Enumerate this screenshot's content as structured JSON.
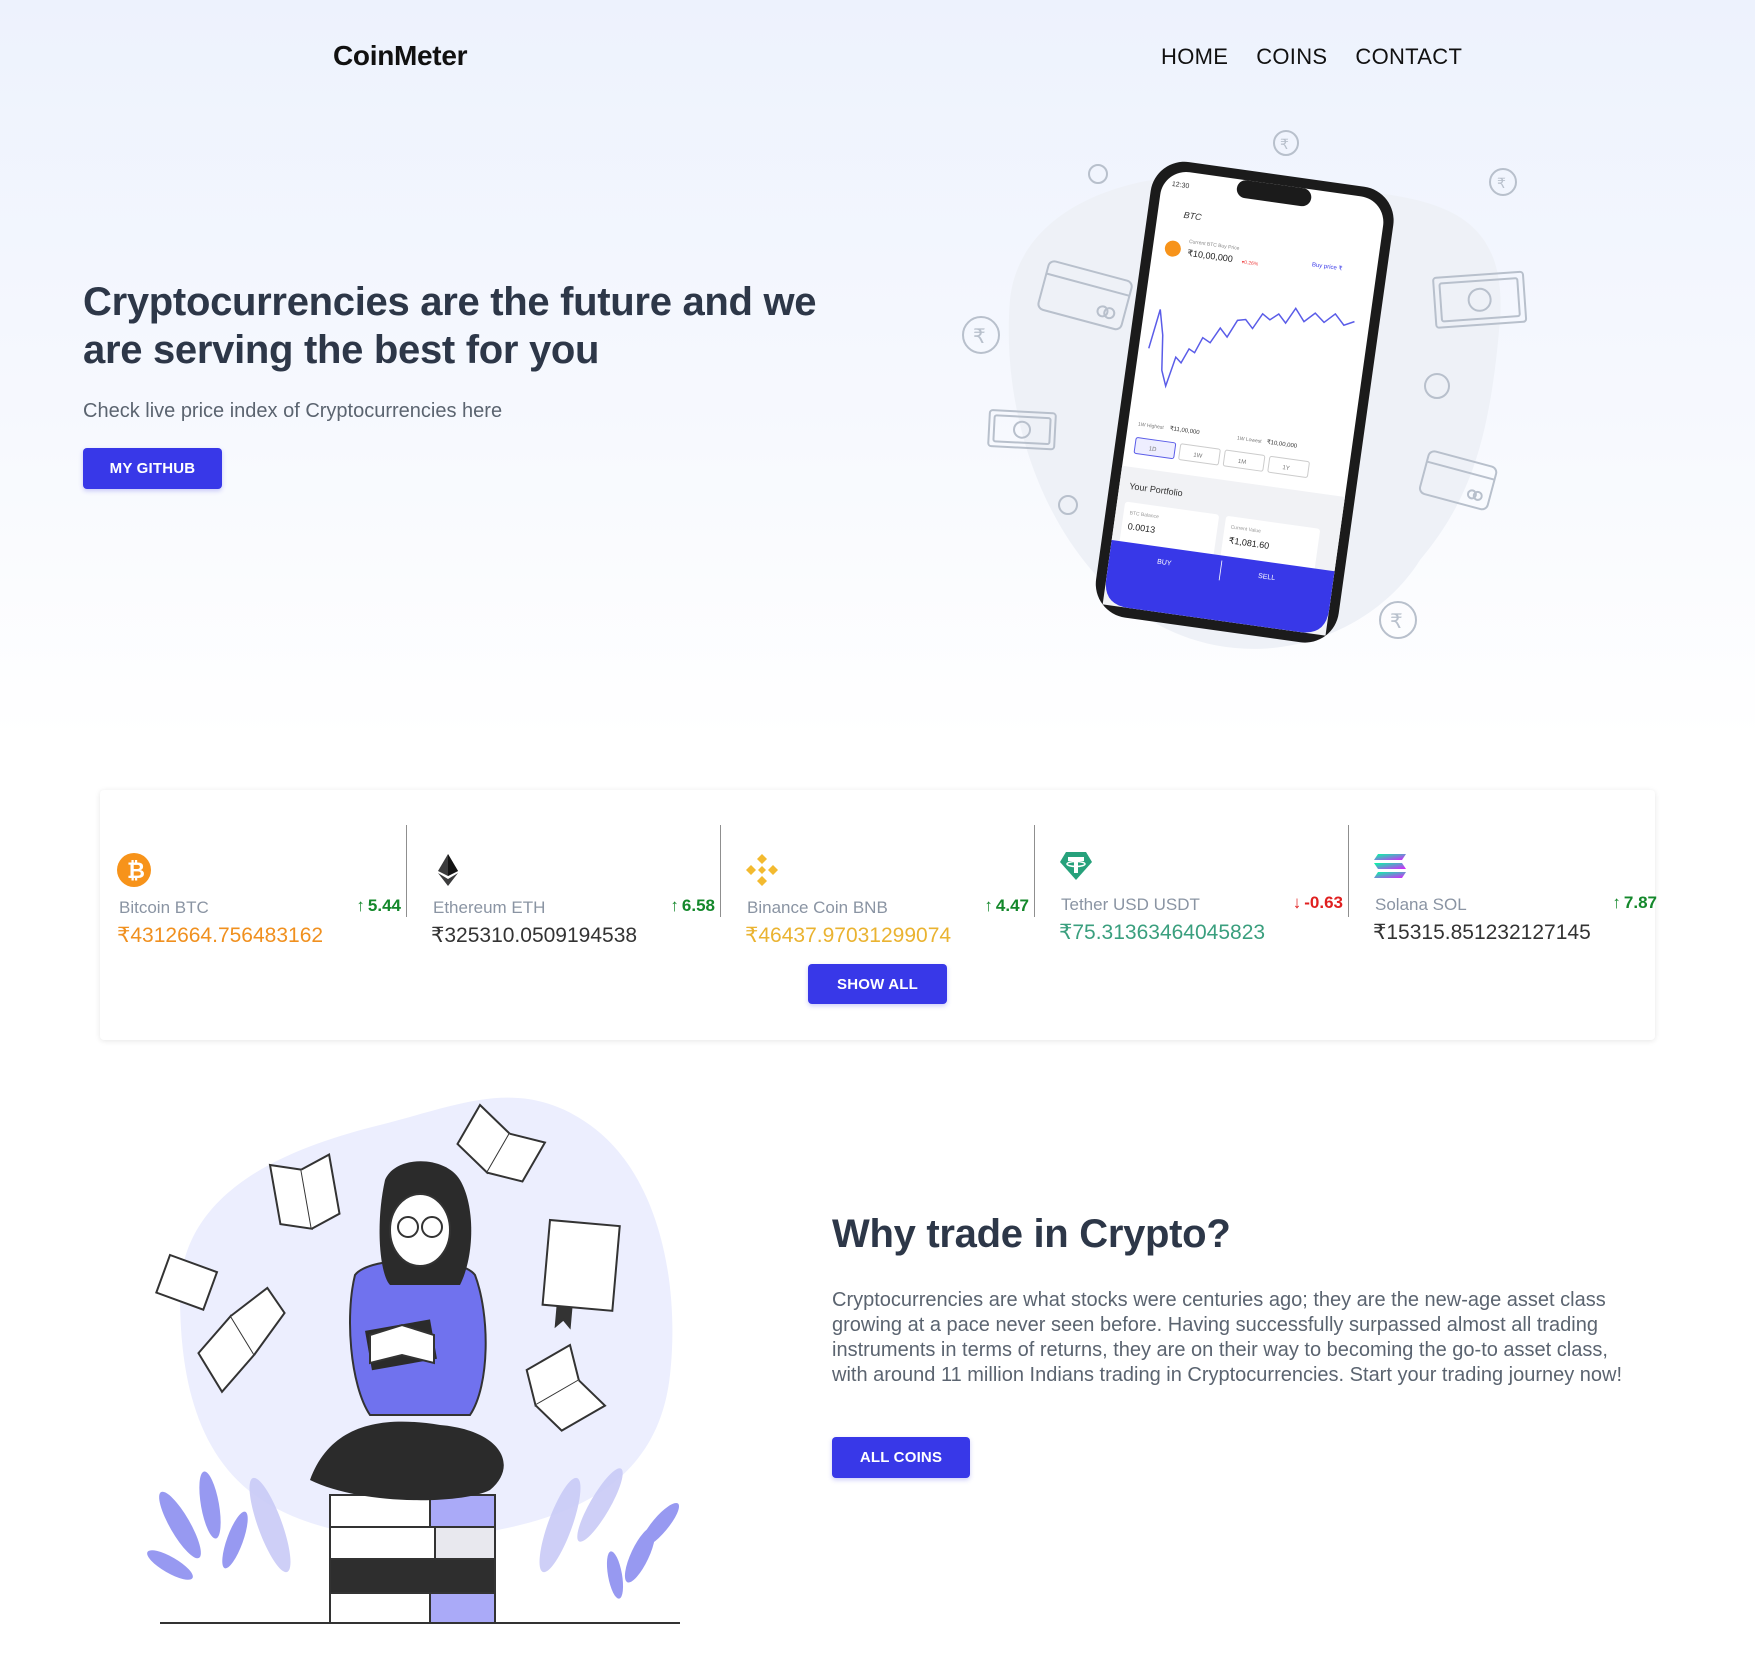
{
  "nav": {
    "brand": "CoinMeter",
    "items": [
      "HOME",
      "COINS",
      "CONTACT"
    ]
  },
  "hero": {
    "title": "Cryptocurrencies are the future and we are serving the best for you",
    "subtitle": "Check live price index of Cryptocurrencies here",
    "github_button": "MY GITHUB",
    "phone": {
      "time": "12:30",
      "coin": "BTC",
      "price_label": "Current BTC Buy Price",
      "price": "₹10,00,000",
      "change": "▾0.26%",
      "buy_price_link": "Buy price ₹",
      "high_label": "1W Highest",
      "high_value": "₹11,00,000",
      "low_label": "1W Lowest",
      "low_value": "₹10,00,000",
      "ranges": [
        "1D",
        "1W",
        "1M",
        "1Y"
      ],
      "portfolio_label": "Your Portfolio",
      "balance_label": "BTC Balance",
      "balance_value": "0.0013",
      "value_label": "Current Value",
      "value_value": "₹1,081.60",
      "buy_label": "BUY",
      "sell_label": "SELL"
    }
  },
  "coins": {
    "items": [
      {
        "icon": "bitcoin-icon",
        "name": "Bitcoin BTC",
        "change": "5.44",
        "direction": "up",
        "price": "₹4312664.756483162",
        "price_color": "#f0901f"
      },
      {
        "icon": "ethereum-icon",
        "name": "Ethereum ETH",
        "change": "6.58",
        "direction": "up",
        "price": "₹325310.0509194538",
        "price_color": "#333333"
      },
      {
        "icon": "binance-icon",
        "name": "Binance Coin BNB",
        "change": "4.47",
        "direction": "up",
        "price": "₹46437.97031299074",
        "price_color": "#eab331"
      },
      {
        "icon": "tether-icon",
        "name": "Tether USD USDT",
        "change": "-0.63",
        "direction": "down",
        "price": "₹75.31363464045823",
        "price_color": "#3a9f7e"
      },
      {
        "icon": "solana-icon",
        "name": "Solana SOL",
        "change": "7.87",
        "direction": "up",
        "price": "₹15315.851232127145",
        "price_color": "#333333"
      }
    ],
    "show_all_button": "SHOW ALL",
    "colors": {
      "up": "#14882b",
      "down": "#e02020"
    }
  },
  "why": {
    "title": "Why trade in Crypto?",
    "text": "Cryptocurrencies are what stocks were centuries ago; they are the new-age asset class growing at a pace never seen before. Having successfully surpassed almost all trading instruments in terms of returns, they are on their way to becoming the go-to asset class, with around 11 million Indians trading in Cryptocurrencies. Start your trading journey now!",
    "all_coins_button": "ALL COINS"
  },
  "colors": {
    "accent": "#3838e8",
    "heading": "#2d3748",
    "muted": "#5b6470"
  }
}
